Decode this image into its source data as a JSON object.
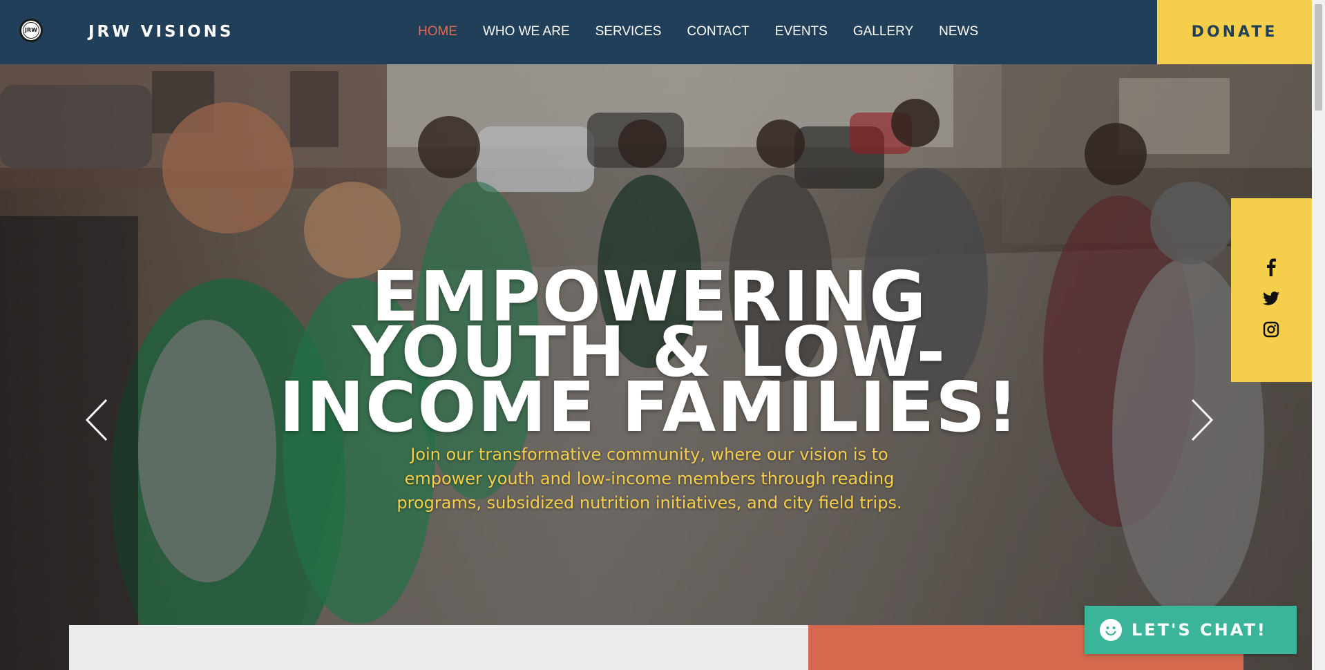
{
  "header": {
    "logo_text": "JRW",
    "brand": "JRW VISIONS",
    "nav": [
      {
        "label": "HOME",
        "active": true
      },
      {
        "label": "WHO WE ARE",
        "active": false
      },
      {
        "label": "SERVICES",
        "active": false
      },
      {
        "label": "CONTACT",
        "active": false
      },
      {
        "label": "EVENTS",
        "active": false
      },
      {
        "label": "GALLERY",
        "active": false
      },
      {
        "label": "NEWS",
        "active": false
      }
    ],
    "donate_label": "DONATE"
  },
  "hero": {
    "headline_lines": [
      "EMPOWERING",
      "YOUTH & LOW-",
      "INCOME FAMILIES!"
    ],
    "subtext": "Join our transformative community, where our vision is to empower youth and low-income members through reading programs, subsidized nutrition initiatives, and city field trips.",
    "prev_icon": "chevron-left-icon",
    "next_icon": "chevron-right-icon"
  },
  "social": {
    "icons": [
      "facebook-icon",
      "twitter-icon",
      "instagram-icon"
    ]
  },
  "chat": {
    "label": "LET'S CHAT!",
    "icon": "smiley-icon"
  },
  "colors": {
    "header_bg": "#213f58",
    "accent_yellow": "#f5cf4b",
    "nav_active": "#e06a53",
    "chat_green": "#3bb59a",
    "panel_orange": "#d5694d",
    "panel_gray": "#ebebeb"
  }
}
